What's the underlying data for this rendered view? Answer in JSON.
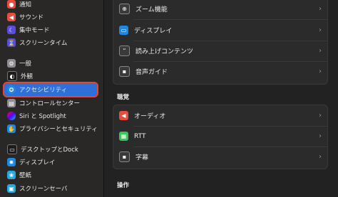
{
  "sidebar": {
    "items": [
      {
        "label": "通知",
        "icon": "bell-icon",
        "color": "#e74c3c"
      },
      {
        "label": "サウンド",
        "icon": "speaker-icon",
        "color": "#e74c3c"
      },
      {
        "label": "集中モード",
        "icon": "moon-icon",
        "color": "#5b4ddb"
      },
      {
        "label": "スクリーンタイム",
        "icon": "hourglass-icon",
        "color": "#5b4ddb"
      },
      {
        "label": "一般",
        "icon": "gear-icon",
        "color": "#8e8e93"
      },
      {
        "label": "外観",
        "icon": "appearance-icon",
        "color": "#1c1c1e"
      },
      {
        "label": "アクセシビリティ",
        "icon": "accessibility-icon",
        "color": "#1e88e5"
      },
      {
        "label": "コントロールセンター",
        "icon": "control-center-icon",
        "color": "#8e8e93"
      },
      {
        "label": "Siri と Spotlight",
        "icon": "siri-icon",
        "color": "#b03aa8"
      },
      {
        "label": "プライバシーとセキュリティ",
        "icon": "privacy-hand-icon",
        "color": "#1e88e5"
      },
      {
        "label": "デスクトップとDock",
        "icon": "desktop-dock-icon",
        "color": "#1c1c1e"
      },
      {
        "label": "ディスプレイ",
        "icon": "display-icon",
        "color": "#1e88e5"
      },
      {
        "label": "壁紙",
        "icon": "wallpaper-icon",
        "color": "#2ba7e0"
      },
      {
        "label": "スクリーンセーバ",
        "icon": "screensaver-icon",
        "color": "#2ba7e0"
      }
    ]
  },
  "main": {
    "vision_rows": [
      {
        "label": "ズーム機能",
        "icon": "zoom-icon",
        "color": "#3a3a3c"
      },
      {
        "label": "ディスプレイ",
        "icon": "display-icon",
        "color": "#1e88e5"
      },
      {
        "label": "読み上げコンテンツ",
        "icon": "spoken-content-icon",
        "color": "#3a3a3c"
      },
      {
        "label": "音声ガイド",
        "icon": "audio-description-icon",
        "color": "#3a3a3c"
      }
    ],
    "hearing_title": "聴覚",
    "hearing_rows": [
      {
        "label": "オーディオ",
        "icon": "audio-icon",
        "color": "#e74c3c"
      },
      {
        "label": "RTT",
        "icon": "rtt-icon",
        "color": "#34c759"
      },
      {
        "label": "字幕",
        "icon": "captions-icon",
        "color": "#3a3a3c"
      }
    ],
    "motor_title": "操作"
  }
}
